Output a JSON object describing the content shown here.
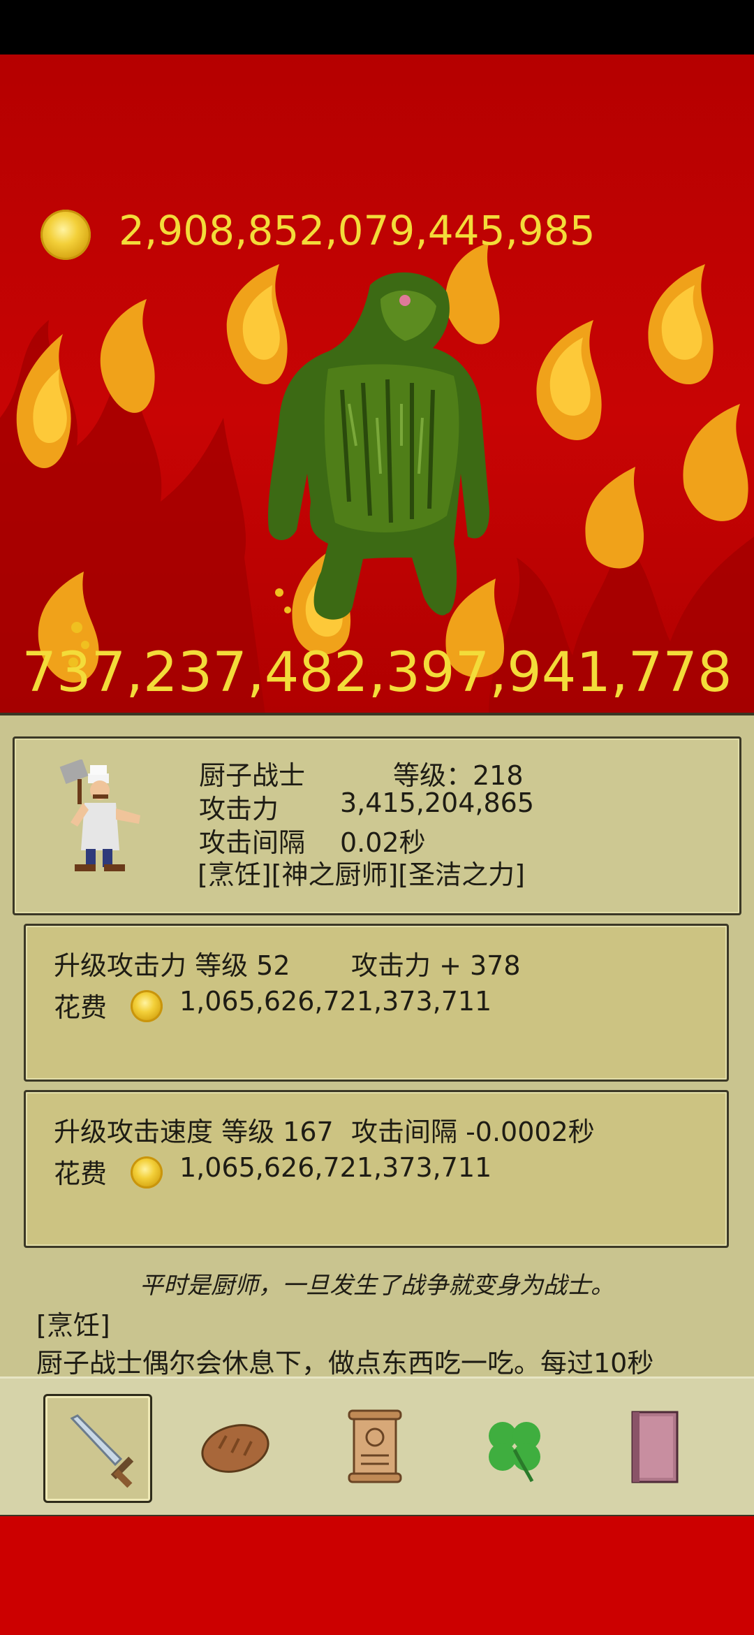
{
  "gold": {
    "amount": "2,908,852,079,445,985"
  },
  "enemy": {
    "hp": "737,237,482,397,941,778"
  },
  "hero": {
    "name": "厨子战士",
    "level_text": "等级：218",
    "attack_label": "攻击力",
    "attack_value": "3,415,204,865",
    "interval_label": "攻击间隔",
    "interval_value": "0.02秒",
    "traits": "[烹饪][神之厨师][圣洁之力]"
  },
  "upgrades": [
    {
      "title": "升级攻击力 等级 52",
      "effect": "攻击力 + 378",
      "cost_label": "花费",
      "cost": "1,065,626,721,373,711"
    },
    {
      "title": "升级攻击速度 等级 167",
      "effect": "攻击间隔 -0.0002秒",
      "cost_label": "花费",
      "cost": "1,065,626,721,373,711"
    }
  ],
  "description": {
    "tagline": "平时是厨师，一旦发生了战争就变身为战士。",
    "skill_title": "[烹饪]",
    "skill_text": "厨子战士偶尔会休息下，做点东西吃一吃。每过10秒"
  },
  "nav": [
    {
      "icon": "sword-icon",
      "active": true
    },
    {
      "icon": "bread-icon",
      "active": false
    },
    {
      "icon": "scroll-icon",
      "active": false
    },
    {
      "icon": "clover-icon",
      "active": false
    },
    {
      "icon": "book-icon",
      "active": false
    }
  ],
  "colors": {
    "gold_text": "#f3dc3a",
    "panel": "#c9c48f",
    "background": "#cc0000"
  }
}
